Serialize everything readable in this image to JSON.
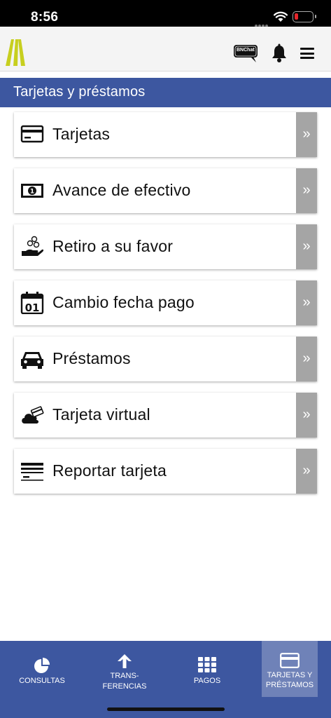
{
  "status_bar": {
    "time": "8:56"
  },
  "header": {
    "chat_badge": "BNChat"
  },
  "section": {
    "title": "Tarjetas y préstamos"
  },
  "menu": {
    "items": [
      {
        "label": "Tarjetas",
        "icon": "credit-card-icon"
      },
      {
        "label": "Avance de efectivo",
        "icon": "cash-bill-icon"
      },
      {
        "label": "Retiro a su favor",
        "icon": "hand-coins-icon"
      },
      {
        "label": "Cambio fecha pago",
        "icon": "calendar-icon"
      },
      {
        "label": "Préstamos",
        "icon": "car-icon"
      },
      {
        "label": "Tarjeta virtual",
        "icon": "cloud-card-icon"
      },
      {
        "label": "Reportar tarjeta",
        "icon": "card-report-icon"
      }
    ],
    "chevron": "»"
  },
  "bottom_nav": {
    "consultas": {
      "line1": "CONSULTAS"
    },
    "transferencias": {
      "line1": "TRANS-",
      "line2": "FERENCIAS"
    },
    "pagos": {
      "line1": "PAGOS"
    },
    "tarjetas": {
      "line1": "TARJETAS Y",
      "line2": "PRÉSTAMOS"
    }
  },
  "colors": {
    "primary": "#3d57a0",
    "active_tab": "#6f82b8",
    "chevron_bg": "#a5a5a5",
    "logo": "#c7cf1f",
    "battery_low": "#e5262b"
  }
}
